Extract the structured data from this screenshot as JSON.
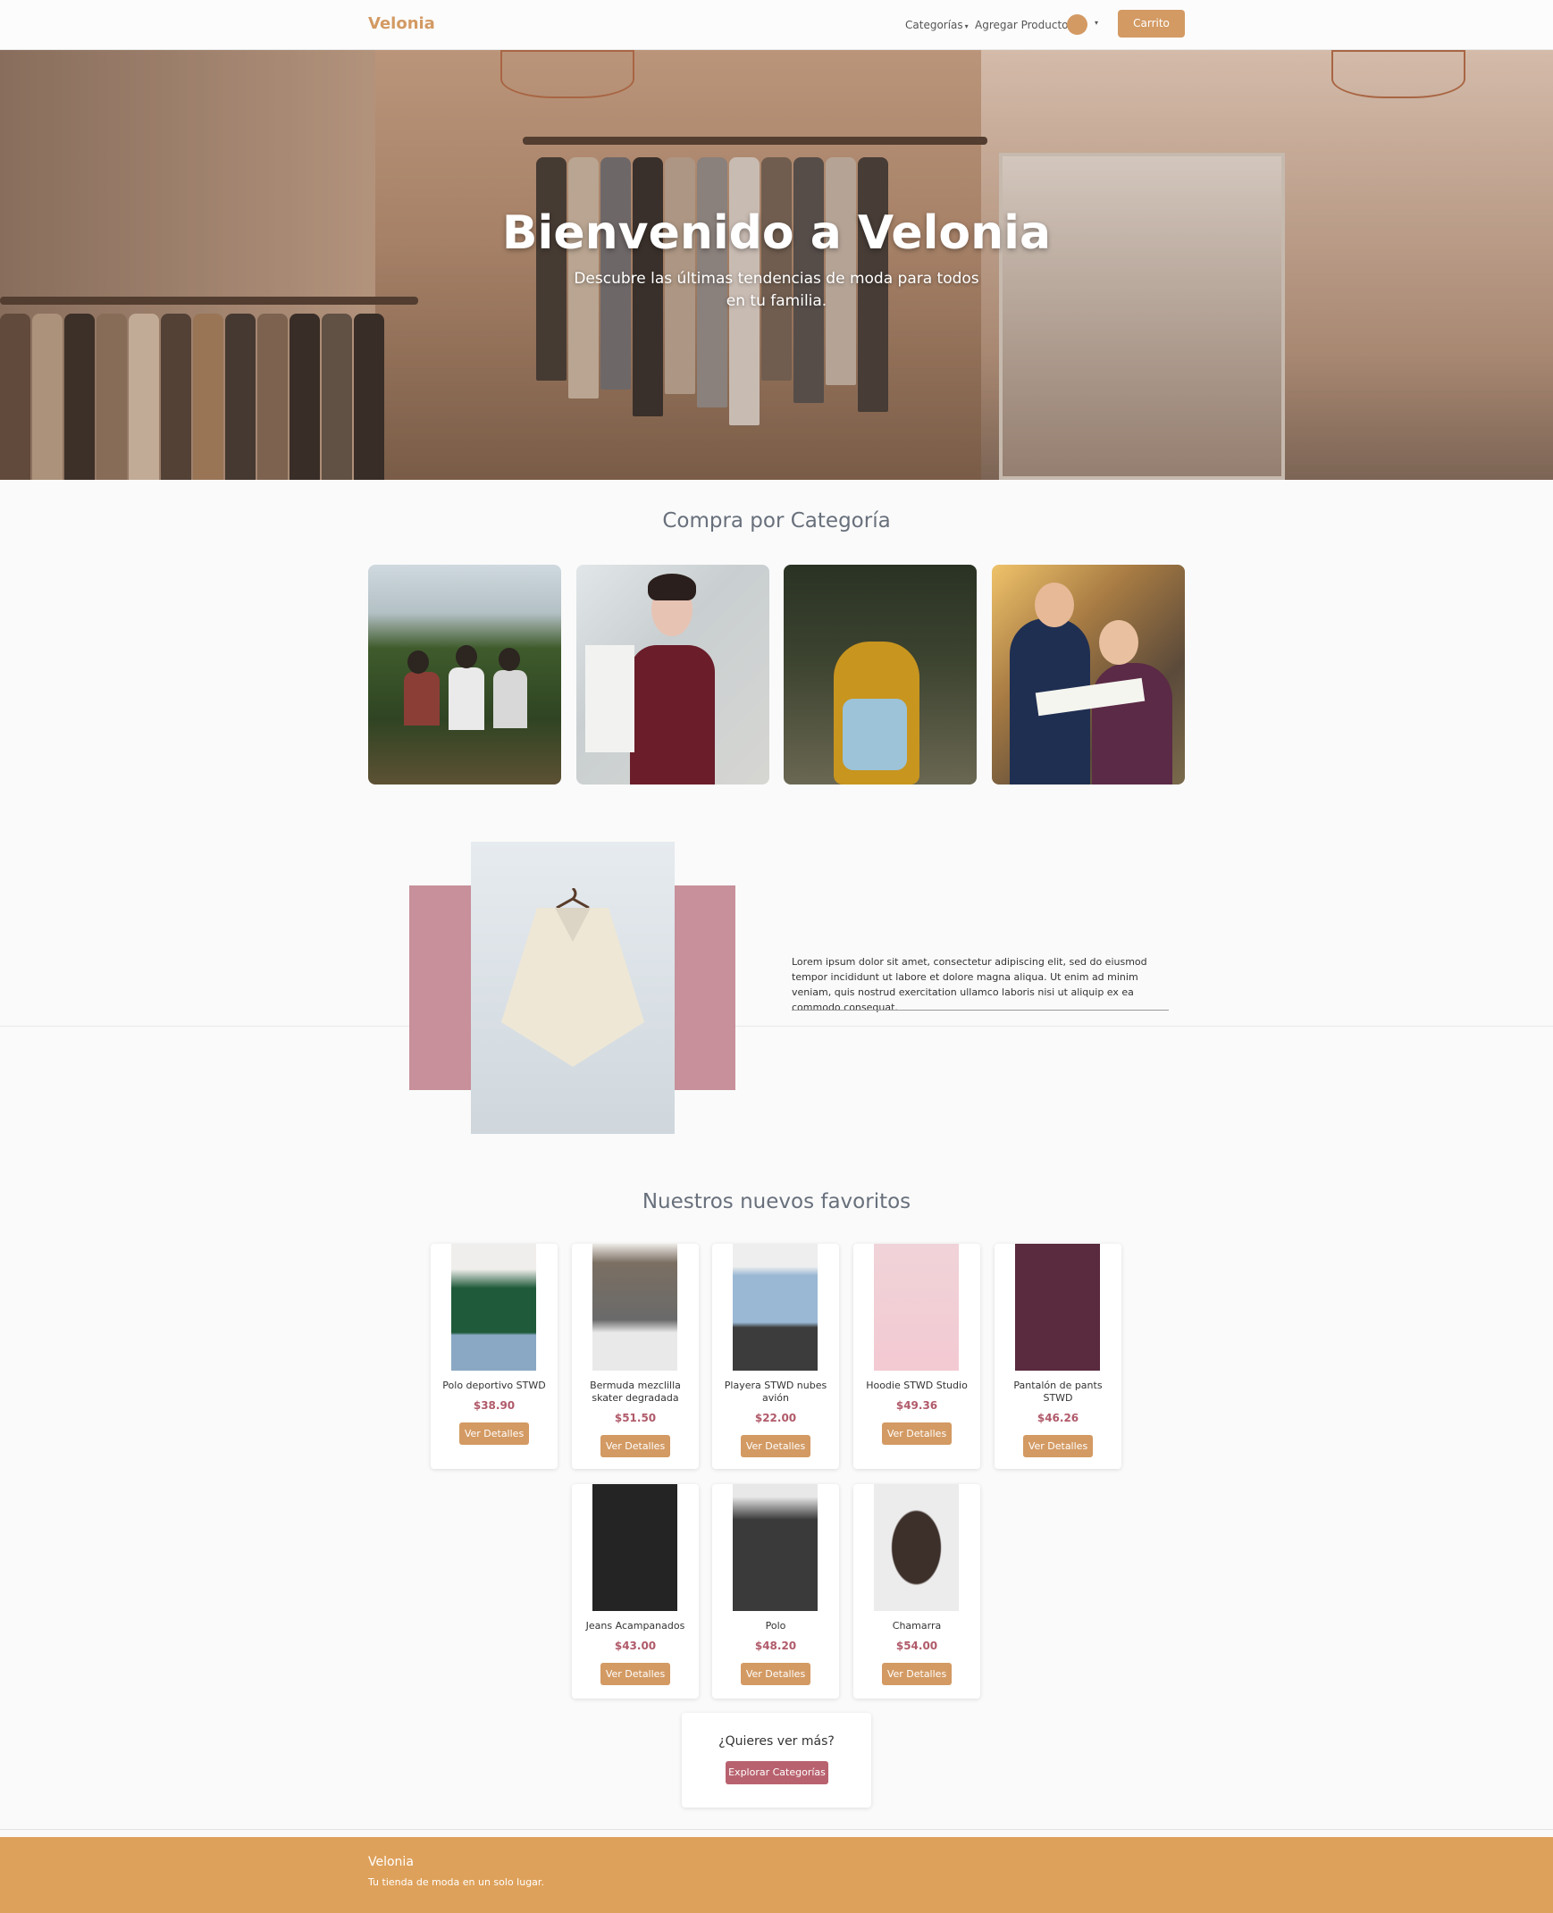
{
  "navbar": {
    "brand": "Velonia",
    "categories_label": "Categorías",
    "add_product_label": "Agregar Producto",
    "cart_label": "Carrito"
  },
  "hero": {
    "title": "Bienvenido a Velonia",
    "subtitle": "Descubre las últimas tendencias de moda para todos en tu familia."
  },
  "categories": {
    "title": "Compra por Categoría"
  },
  "feature": {
    "text": "Lorem ipsum dolor sit amet, consectetur adipiscing elit, sed do eiusmod tempor incididunt ut labore et dolore magna aliqua. Ut enim ad minim veniam, quis nostrud exercitation ullamco laboris nisi ut aliquip ex ea commodo consequat."
  },
  "favorites": {
    "title": "Nuestros nuevos favoritos",
    "button_label": "Ver Detalles",
    "products": [
      {
        "name": "Polo deportivo STWD",
        "price": "$38.90"
      },
      {
        "name": "Bermuda mezclilla skater degradada",
        "price": "$51.50"
      },
      {
        "name": "Playera STWD nubes avión",
        "price": "$22.00"
      },
      {
        "name": "Hoodie STWD Studio",
        "price": "$49.36"
      },
      {
        "name": "Pantalón de pants STWD",
        "price": "$46.26"
      },
      {
        "name": "Jeans Acampanados",
        "price": "$43.00"
      },
      {
        "name": "Polo",
        "price": "$48.20"
      },
      {
        "name": "Chamarra",
        "price": "$54.00"
      }
    ]
  },
  "more": {
    "question": "¿Quieres ver más?",
    "button_label": "Explorar Categorías"
  },
  "footer": {
    "brand": "Velonia",
    "tagline": "Tu tienda de moda en un solo lugar."
  },
  "colors": {
    "accent": "#d39a63",
    "pink": "#c7909a",
    "price": "#b05a6a",
    "footer": "#dea15b"
  }
}
